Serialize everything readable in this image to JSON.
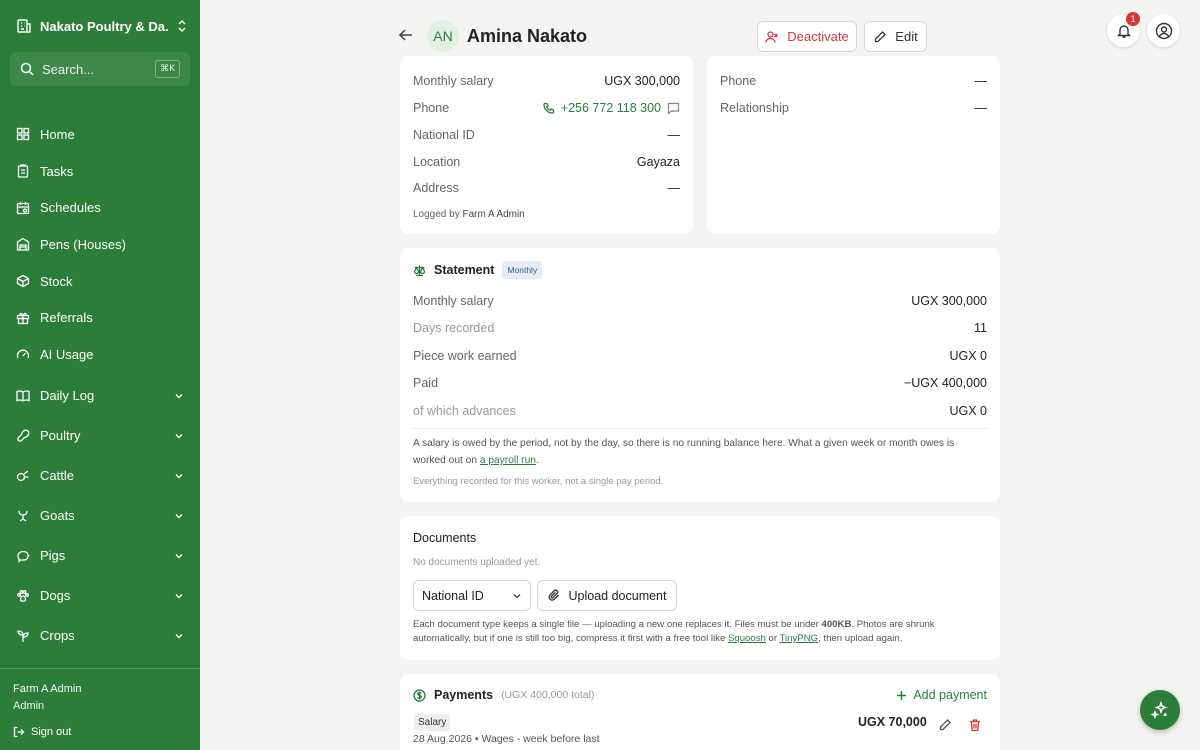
{
  "sidebar": {
    "brand": "Nakato Poultry & Da...",
    "search_placeholder": "Search...",
    "search_shortcut": "⌘K",
    "items": [
      {
        "label": "Home",
        "icon": "home-icon"
      },
      {
        "label": "Tasks",
        "icon": "clipboard-icon"
      },
      {
        "label": "Schedules",
        "icon": "calendar-icon"
      },
      {
        "label": "Pens (Houses)",
        "icon": "warehouse-icon"
      },
      {
        "label": "Stock",
        "icon": "box-icon"
      },
      {
        "label": "Referrals",
        "icon": "gift-icon"
      },
      {
        "label": "AI Usage",
        "icon": "gauge-icon"
      }
    ],
    "groups": [
      {
        "label": "Daily Log"
      },
      {
        "label": "Poultry"
      },
      {
        "label": "Cattle"
      },
      {
        "label": "Goats"
      },
      {
        "label": "Pigs"
      },
      {
        "label": "Dogs"
      },
      {
        "label": "Crops"
      }
    ],
    "user": "Farm A Admin",
    "role": "Admin",
    "signout": "Sign out"
  },
  "header": {
    "initials": "AN",
    "name": "Amina Nakato",
    "deactivate": "Deactivate",
    "edit": "Edit",
    "notif_count": "1"
  },
  "details": {
    "monthly_salary_label": "Monthly salary",
    "monthly_salary": "UGX 300,000",
    "phone_label": "Phone",
    "phone": "+256 772 118 300",
    "national_id_label": "National ID",
    "national_id": "—",
    "location_label": "Location",
    "location": "Gayaza",
    "address_label": "Address",
    "address": "—",
    "logged_by_prefix": "Logged by",
    "logged_by": "Farm A Admin"
  },
  "next_of_kin": {
    "phone_label": "Phone",
    "phone": "—",
    "relationship_label": "Relationship",
    "relationship": "—"
  },
  "statement": {
    "title": "Statement",
    "tag": "Monthly",
    "monthly_salary_label": "Monthly salary",
    "monthly_salary": "UGX 300,000",
    "days_label": "Days recorded",
    "days": "11",
    "piece_label": "Piece work earned",
    "piece": "UGX 0",
    "paid_label": "Paid",
    "paid": "−UGX 400,000",
    "advances_label": "of which advances",
    "advances": "UGX 0",
    "note_a": "A salary is owed by the period, not by the day, so there is no running balance here. What a given week or month owes is worked out on",
    "note_link": "a payroll run",
    "note_b": ".",
    "footnote": "Everything recorded for this worker, not a single pay period."
  },
  "documents": {
    "title": "Documents",
    "empty": "No documents uploaded yet.",
    "select_value": "National ID",
    "upload": "Upload document",
    "note_a": "Each document type keeps a single file — uploading a new one replaces it. Files must be under",
    "note_size": "400KB",
    "note_b": ". Photos are shrunk automatically, but if one is still too big, compress it first with a free tool like",
    "link1": "Squoosh",
    "note_or": "or",
    "link2": "TinyPNG",
    "note_c": ", then upload again."
  },
  "payments": {
    "title": "Payments",
    "total": "(UGX 400,000 total)",
    "add": "Add payment",
    "items": [
      {
        "type": "Salary",
        "amount": "UGX 70,000",
        "desc": "28 Aug 2026 • Wages - week before last"
      }
    ]
  },
  "colors": {
    "brand": "#2d7d3a",
    "danger": "#d9373c"
  }
}
